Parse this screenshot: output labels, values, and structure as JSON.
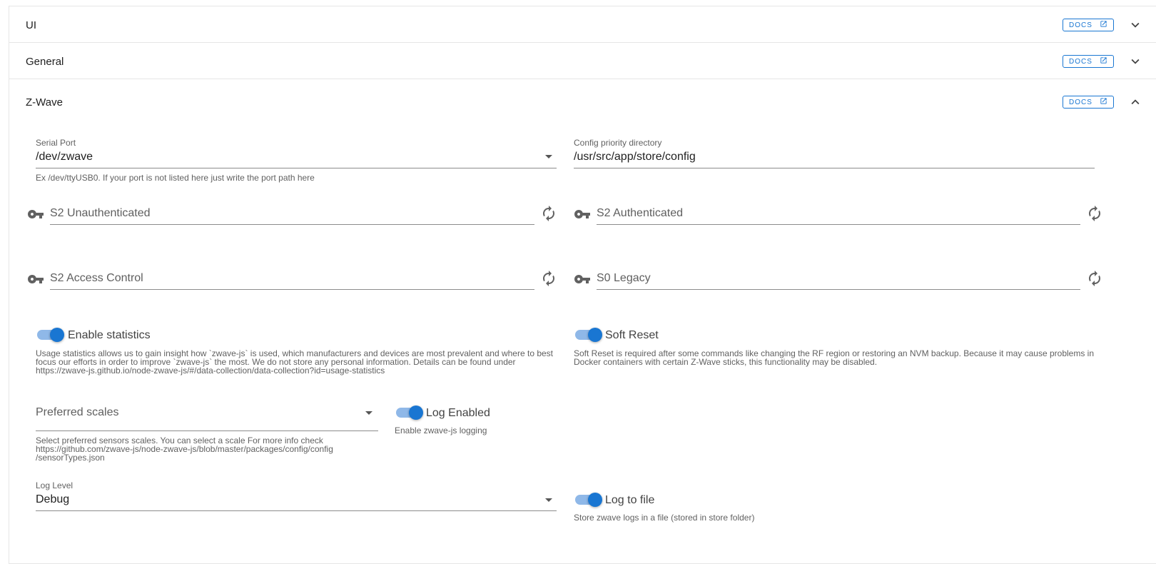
{
  "colors": {
    "accent": "#1976d2",
    "toggle_track": "#8fb8e8"
  },
  "panels": [
    {
      "title": "UI",
      "docs_label": "DOCS",
      "chevron": "chevron-down-icon"
    },
    {
      "title": "General",
      "docs_label": "DOCS",
      "chevron": "chevron-down-icon"
    },
    {
      "title": "Z-Wave",
      "docs_label": "DOCS",
      "chevron": "chevron-up-icon"
    }
  ],
  "zwave": {
    "serial_port": {
      "label": "Serial Port",
      "value": "/dev/zwave",
      "hint": "Ex /dev/ttyUSB0. If your port is not listed here just write the port path here"
    },
    "config_dir": {
      "label": "Config priority directory",
      "value": "/usr/src/app/store/config"
    },
    "keys": {
      "s2_unauthenticated": "S2 Unauthenticated",
      "s2_authenticated": "S2 Authenticated",
      "s2_access_control": "S2 Access Control",
      "s0_legacy": "S0 Legacy"
    },
    "enable_statistics": {
      "label": "Enable statistics",
      "enabled": true,
      "hint_1": "Usage statistics allows us to gain insight how `zwave-js` is used, which manufacturers and devices are most prevalent and where to best",
      "hint_2": "focus our efforts in order to improve `zwave-js` the most. We do not store any personal information. Details can be found under",
      "hint_3": "https://zwave-js.github.io/node-zwave-js/#/data-collection/data-collection?id=usage-statistics"
    },
    "soft_reset": {
      "label": "Soft Reset",
      "enabled": true,
      "hint_1": "Soft Reset is required after some commands like changing the RF region or restoring an NVM backup. Because it may cause problems in",
      "hint_2": "Docker containers with certain Z-Wave sticks, this functionality may be disabled."
    },
    "preferred_scales": {
      "placeholder": "Preferred scales",
      "hint_1": "Select preferred sensors scales. You can select a scale For more info check",
      "hint_2": "https://github.com/zwave-js/node-zwave-js/blob/master/packages/config/config",
      "hint_3": "/sensorTypes.json"
    },
    "log_enabled": {
      "label": "Log Enabled",
      "enabled": true,
      "hint": "Enable zwave-js logging"
    },
    "log_level": {
      "label": "Log Level",
      "value": "Debug"
    },
    "log_to_file": {
      "label": "Log to file",
      "enabled": true,
      "hint": "Store zwave logs in a file (stored in store folder)"
    }
  }
}
